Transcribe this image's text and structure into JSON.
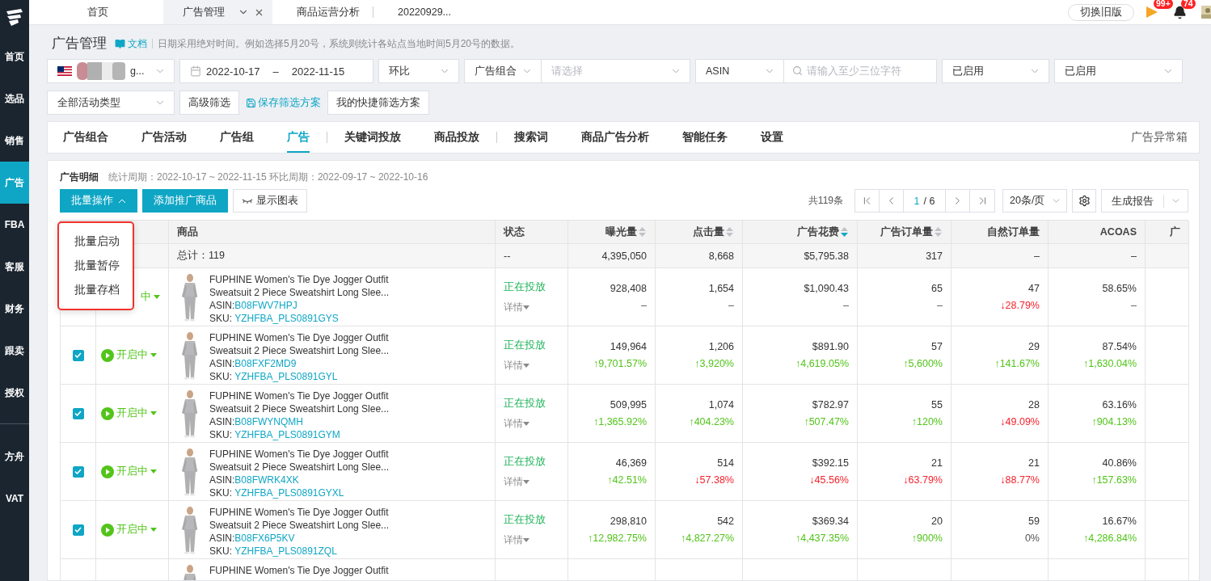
{
  "sidebar": {
    "sections": [
      {
        "items": [
          {
            "label": "首页",
            "selected": false
          },
          {
            "label": "选品",
            "selected": false
          },
          {
            "label": "销售",
            "selected": false
          },
          {
            "label": "广告",
            "selected": true
          },
          {
            "label": "FBA",
            "selected": false
          },
          {
            "label": "客服",
            "selected": false
          },
          {
            "label": "财务",
            "selected": false
          },
          {
            "label": "跟卖",
            "selected": false
          },
          {
            "label": "授权",
            "selected": false
          }
        ]
      },
      {
        "items": [
          {
            "label": "方舟",
            "selected": false
          },
          {
            "label": "VAT",
            "selected": false
          }
        ]
      }
    ]
  },
  "top_tabs": [
    {
      "label": "首页",
      "selected": false,
      "closable": false
    },
    {
      "label": "广告管理",
      "selected": true,
      "closable": true
    },
    {
      "label": "商品运营分析",
      "selected": false,
      "closable": false
    },
    {
      "label": "20220929...",
      "selected": false,
      "closable": false
    }
  ],
  "top_actions": {
    "switch_button": "切换旧版",
    "flag_badge": "99+",
    "bell_badge": "74"
  },
  "page": {
    "title": "广告管理",
    "doc_link": "文档",
    "note": "日期采用绝对时间。例如选择5月20号，系统则统计各站点当地时间5月20号的数据。"
  },
  "filters": {
    "store": "g...",
    "date_start": "2022-10-17",
    "date_separator": "–",
    "date_end": "2022-11-15",
    "compare": "环比",
    "group_type": "广告组合",
    "group_placeholder": "请选择",
    "search_type": "ASIN",
    "search_placeholder": "请输入至少三位字符",
    "status_1": "已启用",
    "status_2": "已启用",
    "activity_type": "全部活动类型",
    "advanced_button": "高级筛选",
    "save_link": "保存筛选方案",
    "quick_button": "我的快捷筛选方案"
  },
  "section_tab_groups": [
    {
      "tabs": [
        {
          "label": "广告组合",
          "selected": false
        },
        {
          "label": "广告活动",
          "selected": false
        },
        {
          "label": "广告组",
          "selected": false
        },
        {
          "label": "广告",
          "selected": true
        }
      ]
    },
    {
      "tabs": [
        {
          "label": "关键词投放",
          "selected": false
        },
        {
          "label": "商品投放",
          "selected": false
        }
      ]
    },
    {
      "tabs": [
        {
          "label": "搜索词",
          "selected": false
        },
        {
          "label": "商品广告分析",
          "selected": false
        },
        {
          "label": "智能任务",
          "selected": false
        },
        {
          "label": "设置",
          "selected": false
        }
      ]
    }
  ],
  "exception_box": "广告异常箱",
  "detail": {
    "title": "广告明细",
    "period": "统计周期：2022-10-17 ~ 2022-11-15 环比周期：2022-09-17 ~ 2022-10-16",
    "batch_button": "批量操作",
    "batch_expanded": true,
    "add_button": "添加推广商品",
    "chart_button": "显示图表",
    "total": "共119条",
    "current_page": "1",
    "page_count": "/ 6",
    "page_size": "20条/页",
    "report_button": "生成报告"
  },
  "batch_menu": [
    "批量启动",
    "批量暂停",
    "批量存档"
  ],
  "table": {
    "columns": [
      {
        "label": "商品",
        "kind": "plain"
      },
      {
        "label": "状态",
        "kind": "plain"
      },
      {
        "label": "曝光量",
        "kind": "sortable"
      },
      {
        "label": "点击量",
        "kind": "sortable"
      },
      {
        "label": "广告花费",
        "kind": "sorted"
      },
      {
        "label": "广告订单量",
        "kind": "sortable"
      },
      {
        "label": "自然订单量",
        "kind": "plain"
      },
      {
        "label": "ACOAS",
        "kind": "plain"
      },
      {
        "label": "广",
        "kind": "plain"
      }
    ],
    "total_row": {
      "product": "总计：119",
      "status": "--",
      "metrics": [
        "4,395,050",
        "8,668",
        "$5,795.38",
        "317",
        "–",
        "–"
      ]
    },
    "rows": [
      {
        "state": "中",
        "state_icon": false,
        "title_lines": [
          "FUPHINE Women's Tie Dye Jogger Outfit",
          "Sweatsuit 2 Piece Sweatshirt Long Slee..."
        ],
        "asin_label": "ASIN:",
        "asin": "B08FWV7HPJ",
        "sku_label": "SKU:",
        "sku": "YZHFBA_PLS0891GYS",
        "status": "正在投放",
        "detail": "详情",
        "metrics": [
          {
            "value": "928,408",
            "change": "–",
            "kind": "none"
          },
          {
            "value": "1,654",
            "change": "–",
            "kind": "none"
          },
          {
            "value": "$1,090.43",
            "change": "–",
            "kind": "none"
          },
          {
            "value": "65",
            "change": "–",
            "kind": "none"
          },
          {
            "value": "47",
            "change": "↓28.79%",
            "kind": "down"
          },
          {
            "value": "58.65%",
            "change": "–",
            "kind": "none"
          }
        ]
      },
      {
        "checked": true,
        "state": "开启中",
        "state_icon": true,
        "title_lines": [
          "FUPHINE Women's Tie Dye Jogger Outfit",
          "Sweatsuit 2 Piece Sweatshirt Long Slee..."
        ],
        "asin_label": "ASIN:",
        "asin": "B08FXF2MD9",
        "sku_label": "SKU:",
        "sku": "YZHFBA_PLS0891GYL",
        "status": "正在投放",
        "detail": "详情",
        "metrics": [
          {
            "value": "149,964",
            "change": "↑9,701.57%",
            "kind": "up"
          },
          {
            "value": "1,206",
            "change": "↑3,920%",
            "kind": "up"
          },
          {
            "value": "$891.90",
            "change": "↑4,619.05%",
            "kind": "up"
          },
          {
            "value": "57",
            "change": "↑5,600%",
            "kind": "up"
          },
          {
            "value": "29",
            "change": "↑141.67%",
            "kind": "up"
          },
          {
            "value": "87.54%",
            "change": "↑1,630.04%",
            "kind": "up"
          }
        ]
      },
      {
        "checked": true,
        "state": "开启中",
        "state_icon": true,
        "title_lines": [
          "FUPHINE Women's Tie Dye Jogger Outfit",
          "Sweatsuit 2 Piece Sweatshirt Long Slee..."
        ],
        "asin_label": "ASIN:",
        "asin": "B08FWYNQMH",
        "sku_label": "SKU:",
        "sku": "YZHFBA_PLS0891GYM",
        "status": "正在投放",
        "detail": "详情",
        "metrics": [
          {
            "value": "509,995",
            "change": "↑1,365.92%",
            "kind": "up"
          },
          {
            "value": "1,074",
            "change": "↑404.23%",
            "kind": "up"
          },
          {
            "value": "$782.97",
            "change": "↑507.47%",
            "kind": "up"
          },
          {
            "value": "55",
            "change": "↑120%",
            "kind": "up"
          },
          {
            "value": "28",
            "change": "↓49.09%",
            "kind": "down"
          },
          {
            "value": "63.16%",
            "change": "↑904.13%",
            "kind": "up"
          }
        ]
      },
      {
        "checked": true,
        "state": "开启中",
        "state_icon": true,
        "title_lines": [
          "FUPHINE Women's Tie Dye Jogger Outfit",
          "Sweatsuit 2 Piece Sweatshirt Long Slee..."
        ],
        "asin_label": "ASIN:",
        "asin": "B08FWRK4XK",
        "sku_label": "SKU:",
        "sku": "YZHFBA_PLS0891GYXL",
        "status": "正在投放",
        "detail": "详情",
        "metrics": [
          {
            "value": "46,369",
            "change": "↑42.51%",
            "kind": "up"
          },
          {
            "value": "514",
            "change": "↓57.38%",
            "kind": "down"
          },
          {
            "value": "$392.15",
            "change": "↓45.56%",
            "kind": "down"
          },
          {
            "value": "21",
            "change": "↓63.79%",
            "kind": "down"
          },
          {
            "value": "21",
            "change": "↓88.77%",
            "kind": "down"
          },
          {
            "value": "40.86%",
            "change": "↑157.63%",
            "kind": "up"
          }
        ]
      },
      {
        "checked": true,
        "state": "开启中",
        "state_icon": true,
        "title_lines": [
          "FUPHINE Women's Tie Dye Jogger Outfit",
          "Sweatsuit 2 Piece Sweatshirt Long Slee..."
        ],
        "asin_label": "ASIN:",
        "asin": "B08FX6P5KV",
        "sku_label": "SKU:",
        "sku": "YZHFBA_PLS0891ZQL",
        "status": "正在投放",
        "detail": "详情",
        "metrics": [
          {
            "value": "298,810",
            "change": "↑12,982.75%",
            "kind": "up"
          },
          {
            "value": "542",
            "change": "↑4,827.27%",
            "kind": "up"
          },
          {
            "value": "$369.34",
            "change": "↑4,437.35%",
            "kind": "up"
          },
          {
            "value": "20",
            "change": "↑900%",
            "kind": "up"
          },
          {
            "value": "59",
            "change": "0%",
            "kind": "flat"
          },
          {
            "value": "16.67%",
            "change": "↑4,286.84%",
            "kind": "up"
          }
        ]
      },
      {
        "title_lines": [
          "FUPHINE Women's Tie Dye Jogger Outfit"
        ]
      }
    ]
  }
}
